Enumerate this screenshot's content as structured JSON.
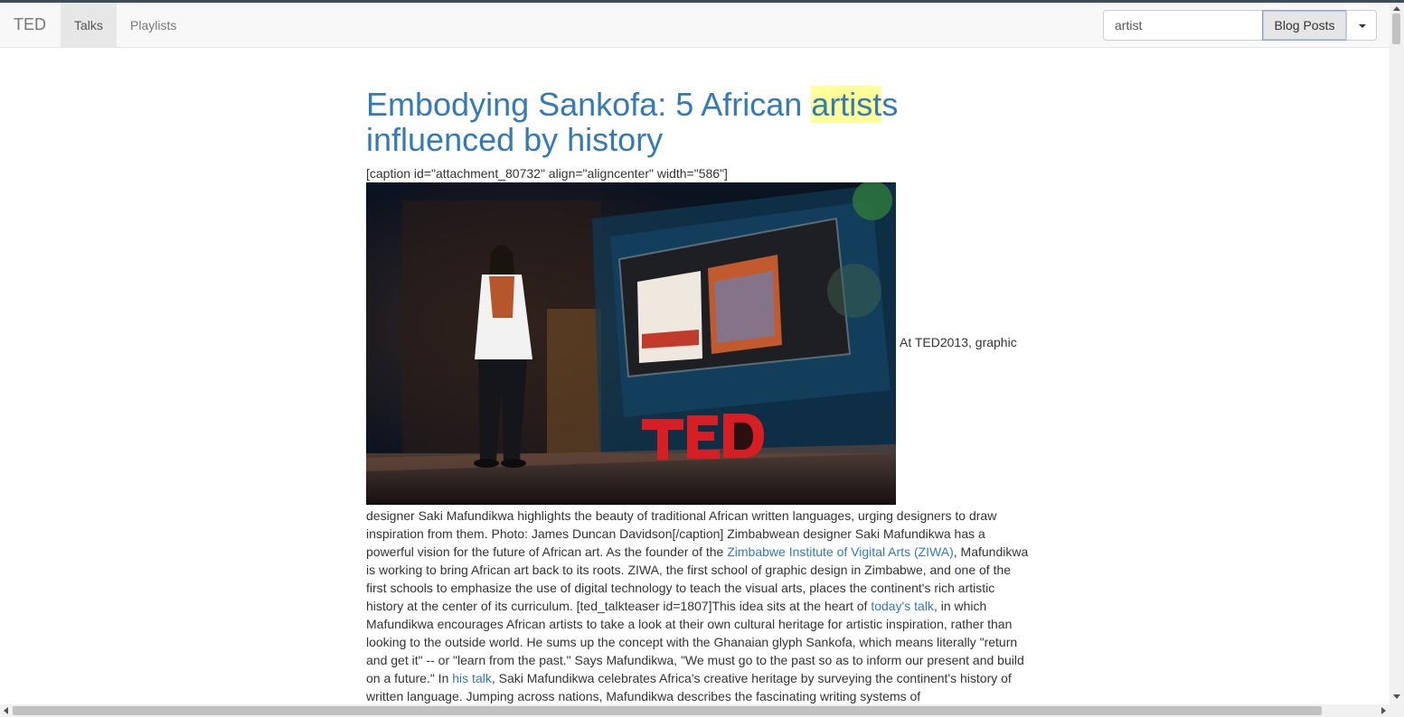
{
  "navbar": {
    "brand": "TED",
    "tabs": [
      {
        "label": "Talks",
        "active": true
      },
      {
        "label": "Playlists",
        "active": false
      }
    ],
    "search": {
      "value": "artist",
      "placeholder": ""
    },
    "search_type": "Blog Posts"
  },
  "post": {
    "title_before": "Embodying Sankofa: 5 African ",
    "title_highlight": "artist",
    "title_after": "s influenced by history",
    "caption_shortcode": "[caption id=\"attachment_80732\" align=\"aligncenter\" width=\"586\"]",
    "image_alt": "Saki Mafundikwa speaking on the TED2013 stage",
    "image_inline_text": "At TED2013, graphic",
    "body": {
      "p1": "designer Saki Mafundikwa highlights the beauty of traditional African written languages, urging designers to draw inspiration from them. Photo: James Duncan Davidson[/caption] Zimbabwean designer Saki Mafundikwa has a powerful vision for the future of African art. As the founder of the ",
      "link1": "Zimbabwe Institute of Vigital Arts (ZIWA)",
      "p2": ", Mafundikwa is working to bring African art back to its roots. ZIWA, the first school of graphic design in Zimbabwe, and one of the first schools to emphasize the use of digital technology to teach the visual arts, places the continent's rich artistic history at the center of its curriculum. [ted_talkteaser id=1807]This idea sits at the heart of ",
      "link2": "today's talk",
      "p3": ", in which Mafundikwa encourages African artists  to take a look at their own cultural heritage for artistic inspiration, rather than looking to the outside world.  He sums up the concept with the Ghanaian glyph Sankofa, which means literally \"return and get it\" -- or \"learn from the past.\" Says Mafundikwa, \"We must go to the past so as to inform our present and build on a future.\" In ",
      "link3": "his talk",
      "p4": ", Saki Mafundikwa celebrates Africa's creative heritage by surveying the continent's history of written language. Jumping across nations, Mafundikwa describes the fascinating writing systems of"
    }
  },
  "icons": {
    "dropdown": "caret-down-icon",
    "scroll_up": "arrow-up-icon",
    "scroll_down": "arrow-down-icon",
    "scroll_left": "arrow-left-icon",
    "scroll_right": "arrow-right-icon"
  },
  "colors": {
    "link": "#337ab7",
    "highlight": "#ffff99",
    "navbar_bg": "#f8f8f8",
    "active_tab_bg": "#e7e7e7"
  }
}
